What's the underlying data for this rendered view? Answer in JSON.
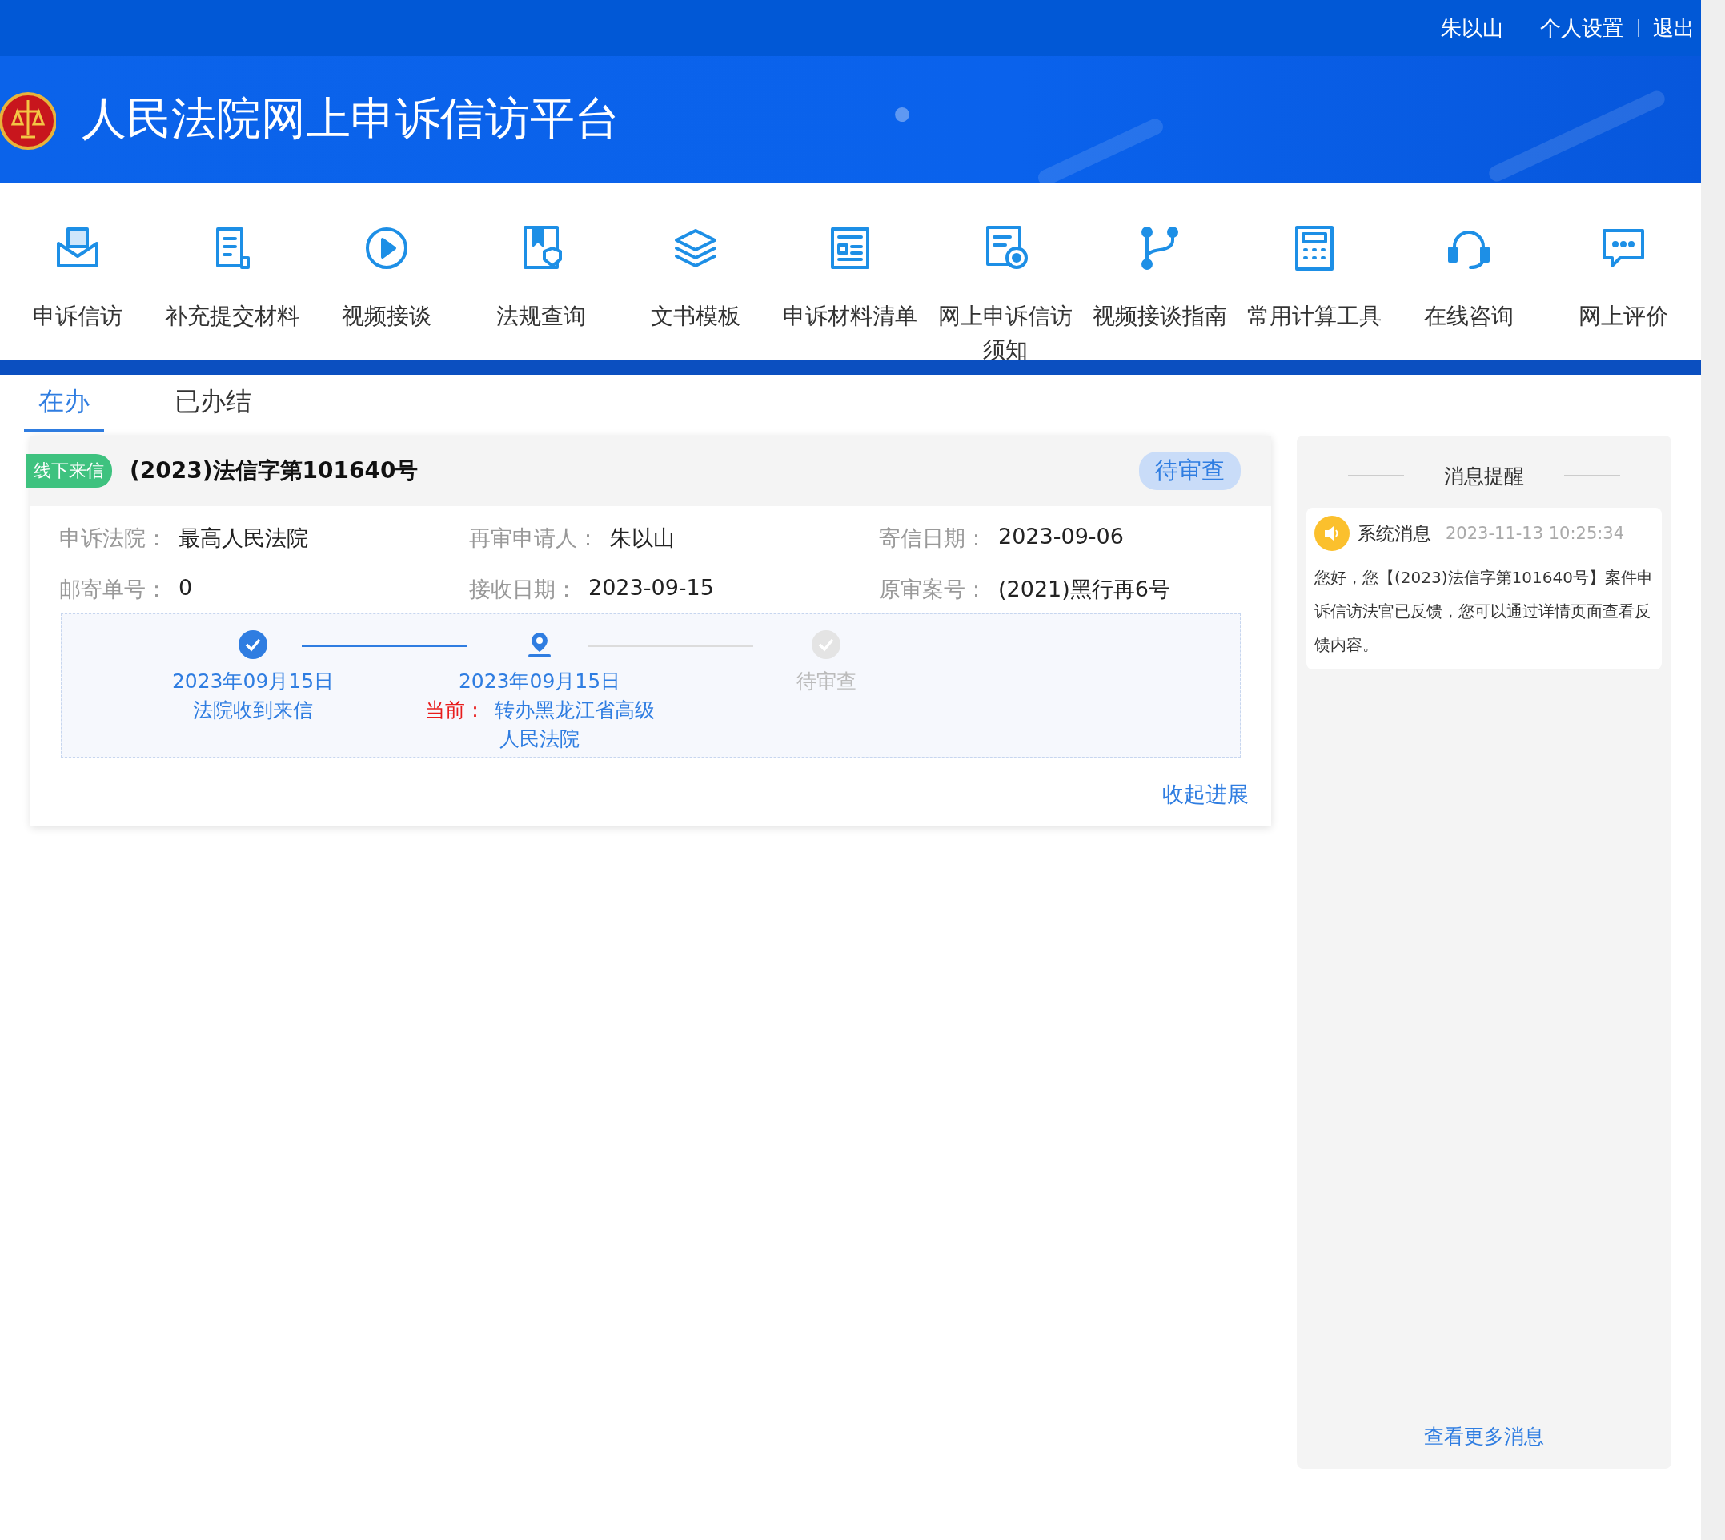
{
  "top_bar": {
    "user": "朱以山",
    "links": [
      "个人设置",
      "退出"
    ]
  },
  "title": "人民法院网上申诉信访平台",
  "nav": [
    {
      "label": "申诉信访",
      "kind": "mail"
    },
    {
      "label": "补充提交材料",
      "kind": "document"
    },
    {
      "label": "视频接谈",
      "kind": "play"
    },
    {
      "label": "法规查询",
      "kind": "shield"
    },
    {
      "label": "文书模板",
      "kind": "layers"
    },
    {
      "label": "申诉材料清单",
      "kind": "list"
    },
    {
      "label": "网上申诉信访须知",
      "kind": "notice"
    },
    {
      "label": "视频接谈指南",
      "kind": "branch"
    },
    {
      "label": "常用计算工具",
      "kind": "calculator"
    },
    {
      "label": "在线咨询",
      "kind": "headset"
    },
    {
      "label": "网上评价",
      "kind": "chat"
    }
  ],
  "tabs": [
    {
      "label": "在办",
      "selected": true
    },
    {
      "label": "已办结",
      "selected": false
    }
  ],
  "case": {
    "tag": "线下来信",
    "number": "(2023)法信字第101640号",
    "status": "待审查",
    "fields": [
      {
        "label": "申诉法院：",
        "value": "最高人民法院"
      },
      {
        "label": "再审申请人：",
        "value": "朱以山"
      },
      {
        "label": "寄信日期：",
        "value": "2023-09-06"
      },
      {
        "label": "邮寄单号：",
        "value": "0"
      },
      {
        "label": "接收日期：",
        "value": "2023-09-15"
      },
      {
        "label": "原审案号：",
        "value": "(2021)黑行再6号"
      }
    ],
    "steps": [
      {
        "kind": "done",
        "date": "2023年09月15日",
        "desc": "法院收到来信"
      },
      {
        "kind": "current",
        "date": "2023年09月15日",
        "prefix": "当前：",
        "desc": "转办黑龙江省高级人民法院"
      },
      {
        "kind": "pending",
        "desc": "待审查"
      }
    ],
    "collapse": "收起进展"
  },
  "messages": {
    "title": "消息提醒",
    "items": [
      {
        "source": "系统消息",
        "time": "2023-11-13 10:25:34",
        "text": "您好，您【(2023)法信字第101640号】案件申诉信访法官已反馈，您可以通过详情页面查看反馈内容。"
      }
    ],
    "more": "查看更多消息"
  }
}
